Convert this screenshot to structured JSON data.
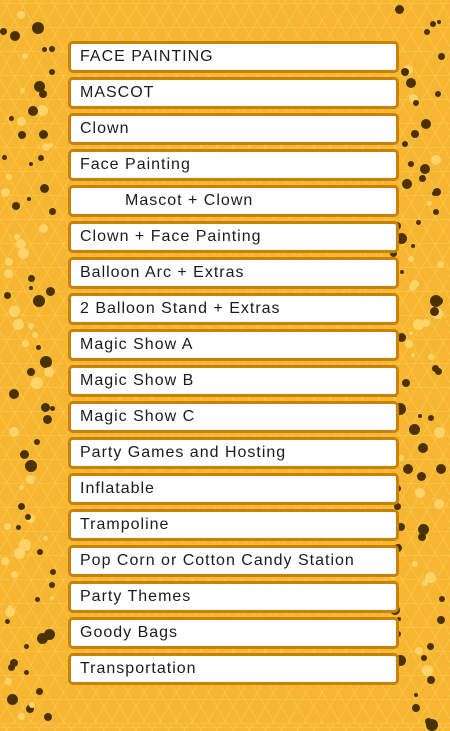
{
  "colors": {
    "background": "#f6b631",
    "item_background": "#ffffff",
    "item_border": "#c98208",
    "dot_dark": "#4a3200",
    "dot_light": "#fdd36a"
  },
  "menu": {
    "items": [
      {
        "label": "FACE PAINTING"
      },
      {
        "label": "MASCOT"
      },
      {
        "label": "Clown"
      },
      {
        "label": "Face Painting"
      },
      {
        "label": "Mascot + Clown"
      },
      {
        "label": "Clown + Face Painting"
      },
      {
        "label": "Balloon Arc + Extras"
      },
      {
        "label": "2 Balloon Stand + Extras"
      },
      {
        "label": "Magic Show A"
      },
      {
        "label": "Magic Show B"
      },
      {
        "label": "Magic Show C"
      },
      {
        "label": "Party Games and Hosting"
      },
      {
        "label": "Inflatable"
      },
      {
        "label": "Trampoline"
      },
      {
        "label": "Pop Corn or Cotton Candy Station"
      },
      {
        "label": "Party Themes"
      },
      {
        "label": "Goody Bags"
      },
      {
        "label": "Transportation"
      }
    ]
  }
}
